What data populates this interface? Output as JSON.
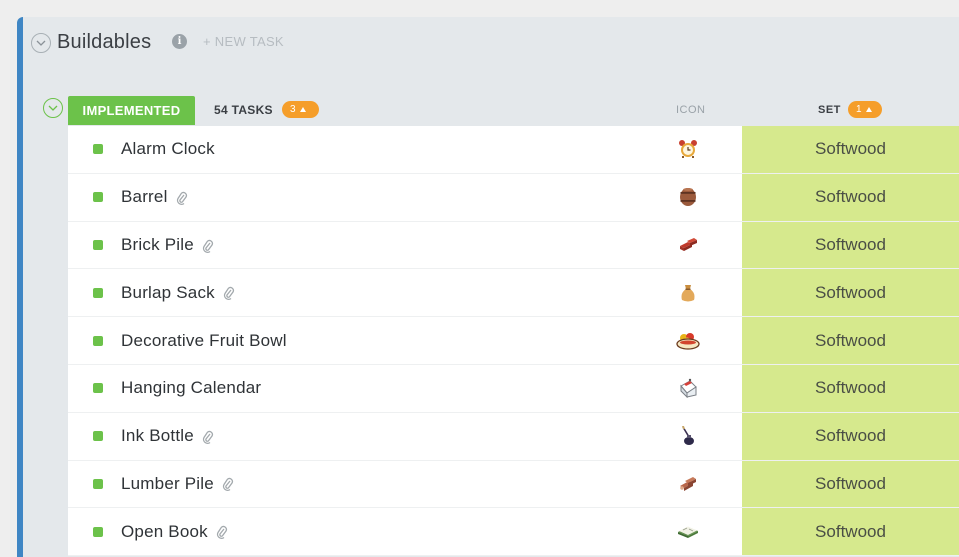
{
  "list": {
    "title": "Buildables",
    "new_task_label": "+ NEW TASK",
    "info_icon": "info-icon",
    "info_glyph": "i"
  },
  "group": {
    "status_label": "IMPLEMENTED",
    "status_color": "#6cc24a",
    "task_count": "54 TASKS",
    "task_badge": "3",
    "badge_color": "#f59e2a",
    "columns": {
      "icon": "ICON",
      "set": "SET",
      "set_badge": "1"
    }
  },
  "colors": {
    "accent": "#3f86c4",
    "set_cell": "#d6e98d"
  },
  "tasks": [
    {
      "name": "Alarm Clock",
      "attachment": false,
      "icon": "alarm-clock-icon",
      "set": "Softwood"
    },
    {
      "name": "Barrel",
      "attachment": true,
      "icon": "barrel-icon",
      "set": "Softwood"
    },
    {
      "name": "Brick Pile",
      "attachment": true,
      "icon": "brick-pile-icon",
      "set": "Softwood"
    },
    {
      "name": "Burlap Sack",
      "attachment": true,
      "icon": "burlap-sack-icon",
      "set": "Softwood"
    },
    {
      "name": "Decorative Fruit Bowl",
      "attachment": false,
      "icon": "fruit-bowl-icon",
      "set": "Softwood"
    },
    {
      "name": "Hanging Calendar",
      "attachment": false,
      "icon": "calendar-icon",
      "set": "Softwood"
    },
    {
      "name": "Ink Bottle",
      "attachment": true,
      "icon": "ink-bottle-icon",
      "set": "Softwood"
    },
    {
      "name": "Lumber Pile",
      "attachment": true,
      "icon": "lumber-pile-icon",
      "set": "Softwood"
    },
    {
      "name": "Open Book",
      "attachment": true,
      "icon": "open-book-icon",
      "set": "Softwood"
    }
  ]
}
